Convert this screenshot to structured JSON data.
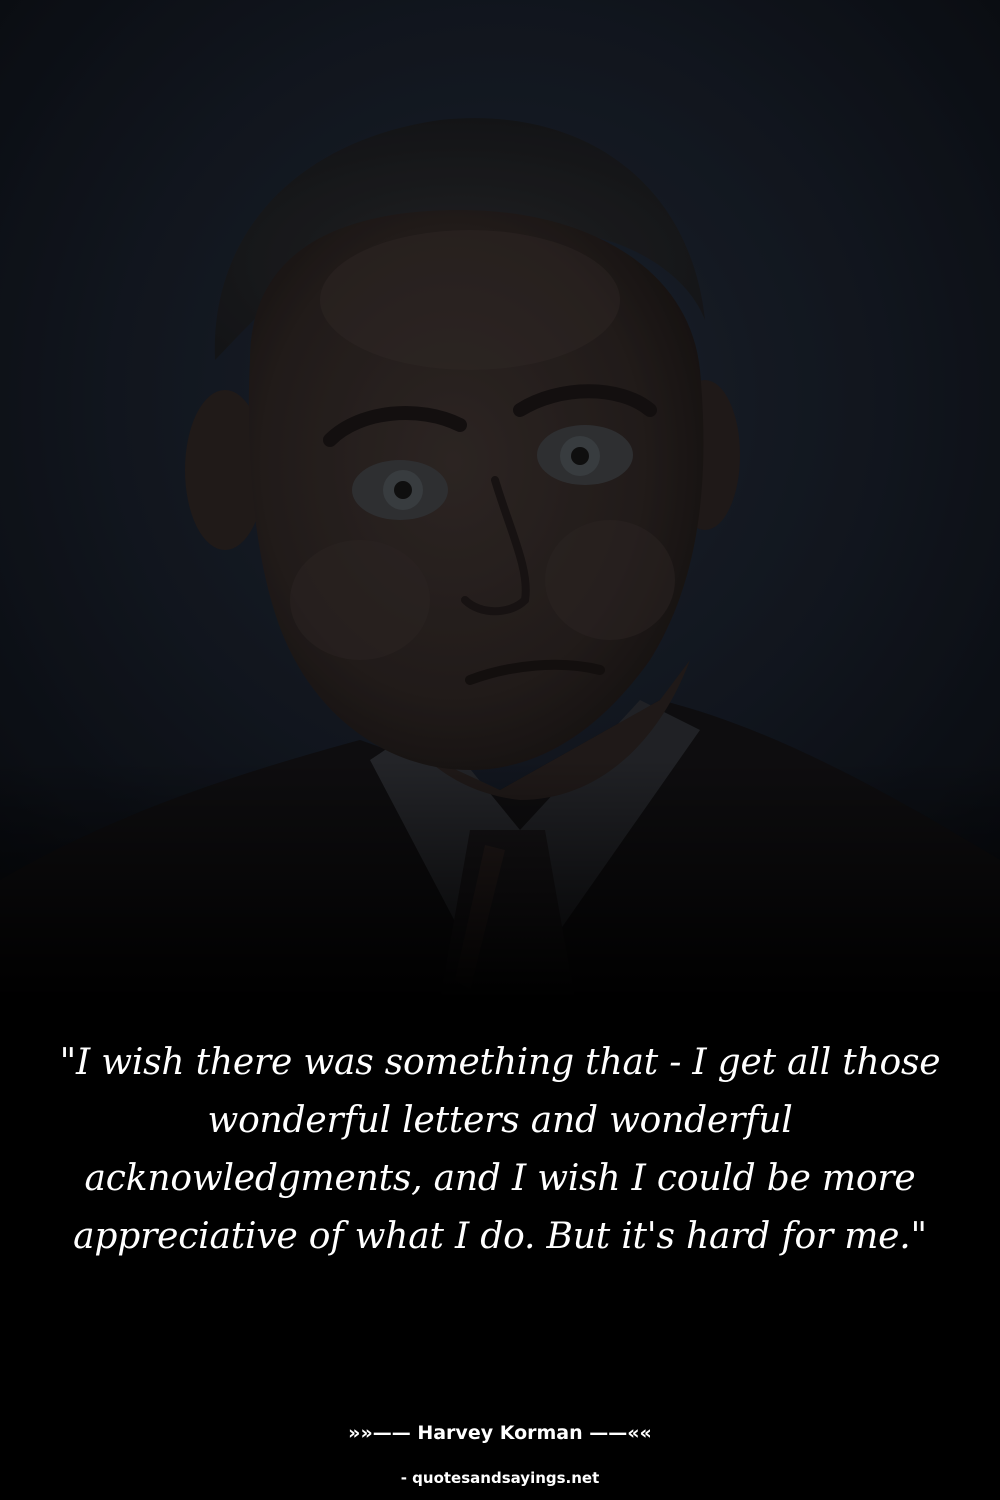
{
  "quote": {
    "text": "\"I wish there was something that - I get all those wonderful letters and wonderful acknowledgments, and I wish I could be more appreciative of what I do. But it's hard for me.\""
  },
  "author": {
    "text": "»»—— Harvey Korman ——««"
  },
  "source": {
    "text": "- quotesandsayings.net"
  },
  "colors": {
    "background": "#000000",
    "text": "#ffffff"
  }
}
